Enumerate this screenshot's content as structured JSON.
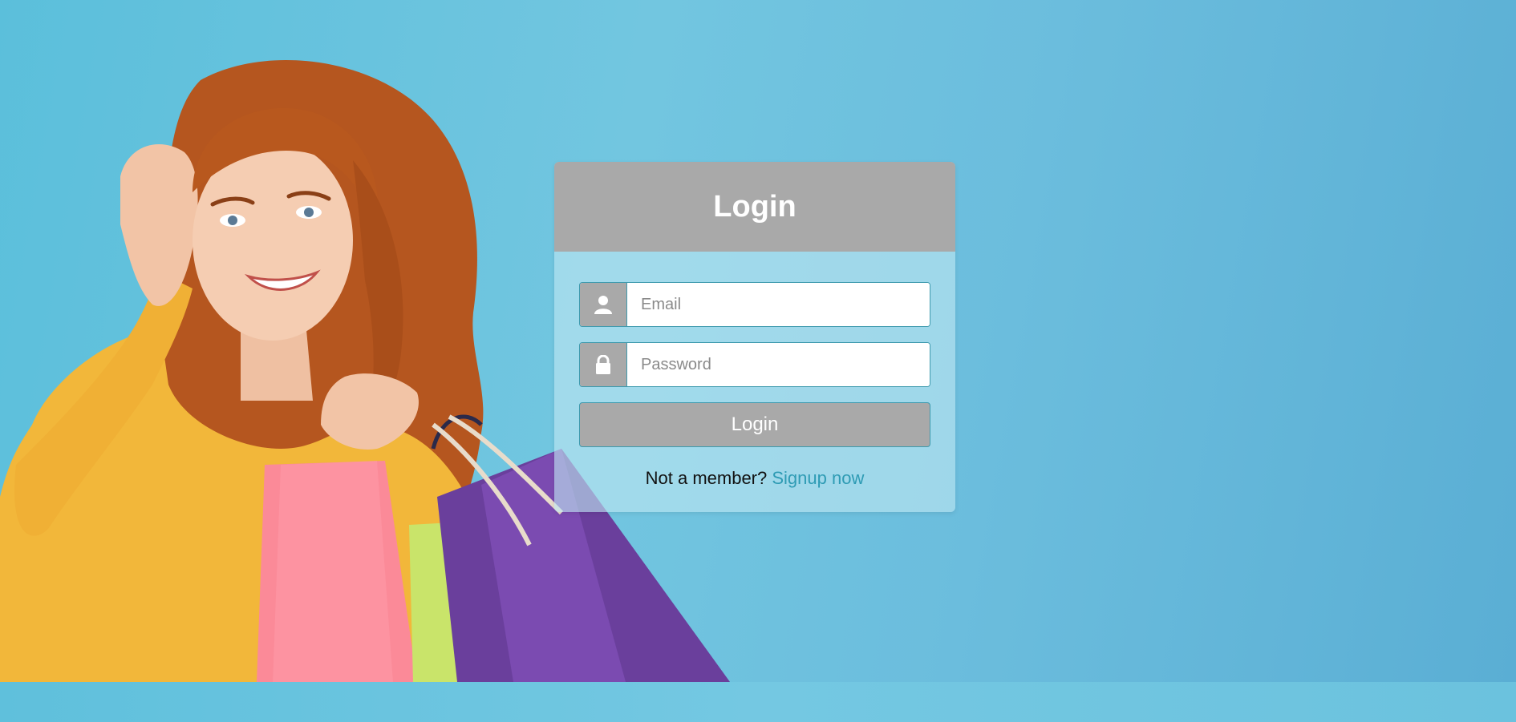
{
  "login_card": {
    "title": "Login",
    "email_placeholder": "Email",
    "email_value": "",
    "email_icon": "user-icon",
    "password_placeholder": "Password",
    "password_value": "",
    "password_icon": "lock-icon",
    "submit_label": "Login",
    "signup_prompt": "Not a member?",
    "signup_link": "Signup now"
  },
  "colors": {
    "background": "#6bc3de",
    "card_header": "#a9a9a9",
    "link": "#2e9bb4",
    "input_border": "#3e9aae"
  }
}
